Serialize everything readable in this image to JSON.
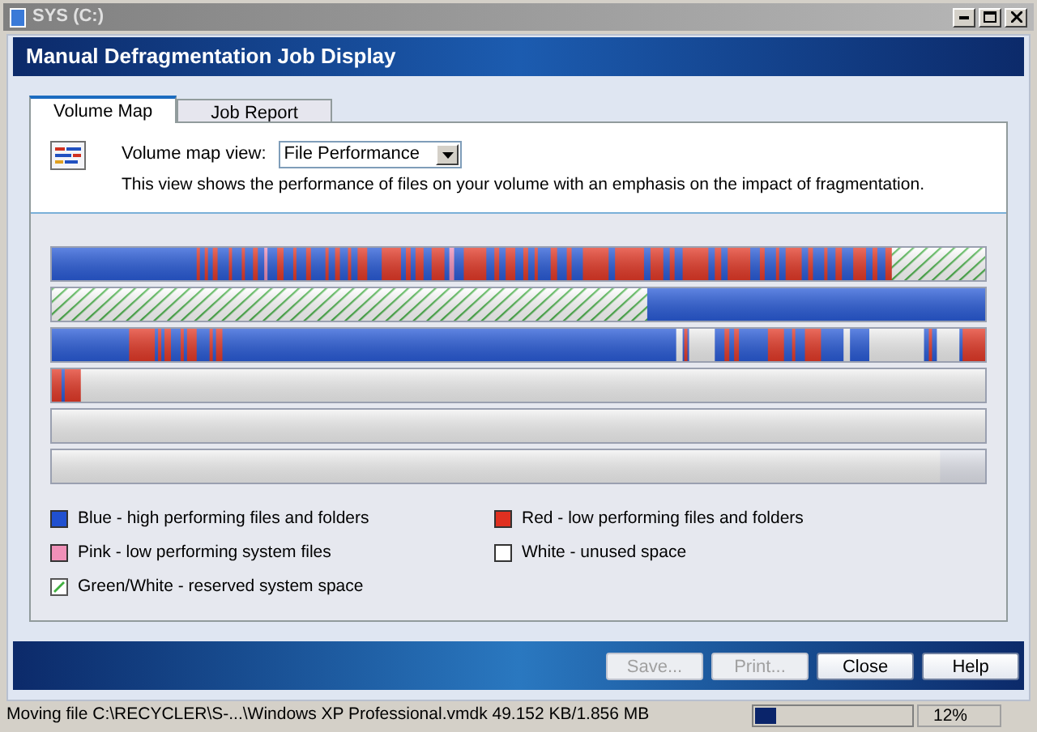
{
  "window": {
    "title": "SYS (C:)"
  },
  "header": {
    "title": "Manual Defragmentation Job Display"
  },
  "tabs": [
    {
      "label": "Volume Map",
      "selected": true
    },
    {
      "label": "Job Report",
      "selected": false
    }
  ],
  "view_selector": {
    "label": "Volume map view:",
    "value": "File Performance",
    "description": "This view shows the performance of files on your volume with an emphasis on the impact of fragmentation."
  },
  "legend": [
    {
      "kind": "solid",
      "color": "#2050d0",
      "label": "Blue - high performing files and folders"
    },
    {
      "kind": "solid",
      "color": "#e03020",
      "label": "Red - low performing files and folders"
    },
    {
      "kind": "solid",
      "color": "#f090b8",
      "label": "Pink - low performing system files"
    },
    {
      "kind": "solid",
      "color": "#ffffff",
      "label": "White - unused space"
    },
    {
      "kind": "hatch",
      "color": "#40b040",
      "label": "Green/White - reserved system space"
    }
  ],
  "buttons": [
    {
      "label": "Save...",
      "disabled": true
    },
    {
      "label": "Print...",
      "disabled": true
    },
    {
      "label": "Close",
      "disabled": false
    },
    {
      "label": "Help",
      "disabled": false
    }
  ],
  "status_bar": {
    "message": "Moving file C:\\RECYCLER\\S-...\\Windows XP Professional.vmdk  49.152 KB/1.856 MB",
    "progress": {
      "level": 0.14
    },
    "percent": "12%"
  }
}
